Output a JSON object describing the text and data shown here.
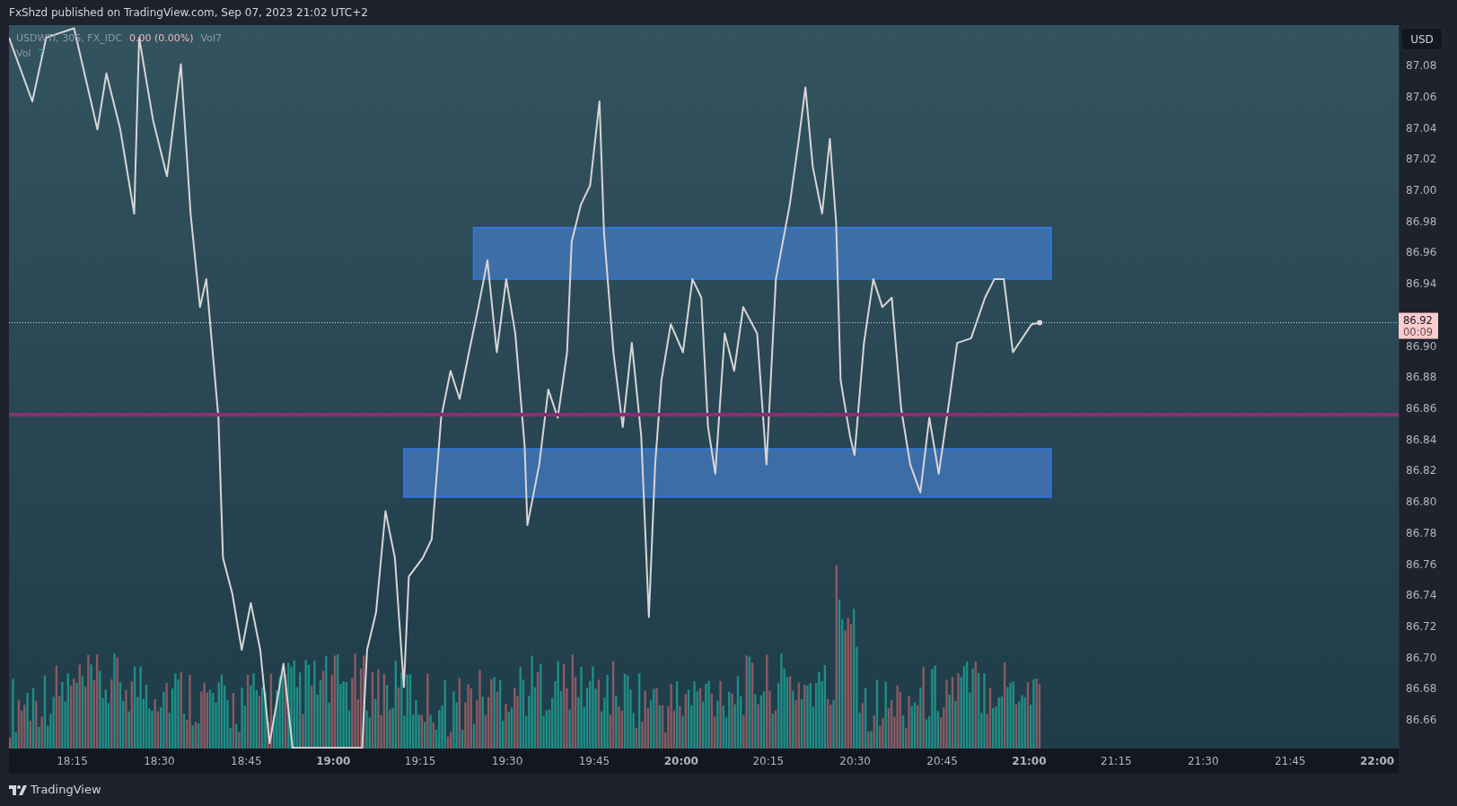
{
  "header": {
    "text": "FxShzd published on TradingView.com, Sep 07, 2023 21:02 UTC+2"
  },
  "legend": {
    "symbol": "USDWTI, 30S, FX_IDC",
    "change": "0.00 (0.00%)",
    "volume_label": "Vol7",
    "volume_name": "Vol",
    "volume_value": "7"
  },
  "price_axis": {
    "currency": "USD",
    "countdown": "00:09"
  },
  "chart": {
    "chart_data": {
      "type": "line",
      "x": [
        18.068,
        18.135,
        18.175,
        18.255,
        18.322,
        18.348,
        18.388,
        18.428,
        18.442,
        18.482,
        18.522,
        18.562,
        18.59,
        18.617,
        18.635,
        18.67,
        18.683,
        18.71,
        18.737,
        18.763,
        18.79,
        18.817,
        18.857,
        18.883,
        19.083,
        19.097,
        19.123,
        19.15,
        19.177,
        19.203,
        19.217,
        19.257,
        19.283,
        19.31,
        19.337,
        19.363,
        19.39,
        19.417,
        19.443,
        19.47,
        19.497,
        19.523,
        19.55,
        19.558,
        19.592,
        19.618,
        19.645,
        19.672,
        19.685,
        19.712,
        19.738,
        19.765,
        19.778,
        19.805,
        19.832,
        19.858,
        19.885,
        19.907,
        19.925,
        19.943,
        19.97,
        20.005,
        20.032,
        20.058,
        20.077,
        20.098,
        20.125,
        20.152,
        20.178,
        20.218,
        20.245,
        20.272,
        20.312,
        20.338,
        20.357,
        20.378,
        20.405,
        20.427,
        20.445,
        20.458,
        20.485,
        20.498,
        20.525,
        20.552,
        20.578,
        20.605,
        20.632,
        20.658,
        20.687,
        20.713,
        20.74,
        20.767,
        20.793,
        20.833,
        20.873,
        20.9,
        20.927,
        20.953,
        20.98,
        21.007,
        21.03
      ],
      "series": [
        {
          "color": "#d9d5d8",
          "values": [
            87.098,
            87.057,
            87.098,
            87.104,
            87.039,
            87.075,
            87.039,
            86.985,
            87.098,
            87.045,
            87.009,
            87.081,
            86.985,
            86.925,
            86.943,
            86.854,
            86.764,
            86.741,
            86.705,
            86.735,
            86.705,
            86.645,
            86.696,
            86.642,
            86.642,
            86.705,
            86.729,
            86.794,
            86.764,
            86.681,
            86.752,
            86.764,
            86.776,
            86.854,
            86.884,
            86.866,
            86.896,
            86.925,
            86.955,
            86.896,
            86.943,
            86.908,
            86.836,
            86.785,
            86.824,
            86.872,
            86.854,
            86.896,
            86.967,
            86.991,
            87.003,
            87.057,
            86.973,
            86.896,
            86.848,
            86.902,
            86.842,
            86.726,
            86.824,
            86.878,
            86.914,
            86.896,
            86.943,
            86.931,
            86.848,
            86.818,
            86.908,
            86.884,
            86.925,
            86.908,
            86.824,
            86.943,
            86.991,
            87.033,
            87.066,
            87.015,
            86.985,
            87.033,
            86.979,
            86.878,
            86.842,
            86.83,
            86.902,
            86.943,
            86.925,
            86.931,
            86.86,
            86.824,
            86.806,
            86.854,
            86.818,
            86.86,
            86.902,
            86.905,
            86.931,
            86.943,
            86.943,
            86.896,
            86.905,
            86.914,
            86.915
          ]
        }
      ],
      "xlim": [
        18.068,
        22.0617
      ],
      "ylim": [
        86.6416,
        87.106
      ],
      "xticks": [
        {
          "value": 18.25,
          "label": "18:15"
        },
        {
          "value": 18.5,
          "label": "18:30"
        },
        {
          "value": 18.75,
          "label": "18:45"
        },
        {
          "value": 19,
          "label": "19:00"
        },
        {
          "value": 19.25,
          "label": "19:15"
        },
        {
          "value": 19.5,
          "label": "19:30"
        },
        {
          "value": 19.75,
          "label": "19:45"
        },
        {
          "value": 20,
          "label": "20:00"
        },
        {
          "value": 20.25,
          "label": "20:15"
        },
        {
          "value": 20.5,
          "label": "20:30"
        },
        {
          "value": 20.75,
          "label": "20:45"
        },
        {
          "value": 21,
          "label": "21:00"
        },
        {
          "value": 21.25,
          "label": "21:15"
        },
        {
          "value": 21.5,
          "label": "21:30"
        },
        {
          "value": 21.75,
          "label": "21:45"
        },
        {
          "value": 22,
          "label": "22:00"
        }
      ],
      "yticks": [
        {
          "value": 87.08,
          "label": "87.08"
        },
        {
          "value": 87.06,
          "label": "87.06"
        },
        {
          "value": 87.04,
          "label": "87.04"
        },
        {
          "value": 87.02,
          "label": "87.02"
        },
        {
          "value": 87.0,
          "label": "87.00"
        },
        {
          "value": 86.98,
          "label": "86.98"
        },
        {
          "value": 86.96,
          "label": "86.96"
        },
        {
          "value": 86.94,
          "label": "86.94"
        },
        {
          "value": 86.9,
          "label": "86.90"
        },
        {
          "value": 86.88,
          "label": "86.88"
        },
        {
          "value": 86.86,
          "label": "86.86"
        },
        {
          "value": 86.84,
          "label": "86.84"
        },
        {
          "value": 86.82,
          "label": "86.82"
        },
        {
          "value": 86.8,
          "label": "86.80"
        },
        {
          "value": 86.78,
          "label": "86.78"
        },
        {
          "value": 86.76,
          "label": "86.76"
        },
        {
          "value": 86.74,
          "label": "86.74"
        },
        {
          "value": 86.72,
          "label": "86.72"
        },
        {
          "value": 86.7,
          "label": "86.70"
        },
        {
          "value": 86.68,
          "label": "86.68"
        },
        {
          "value": 86.66,
          "label": "86.66"
        }
      ],
      "bands": [
        {
          "axis": "y",
          "from": 86.943,
          "to": 86.976
        },
        {
          "axis": "y",
          "from": 86.803,
          "to": 86.834
        }
      ],
      "ref_lines": [
        {
          "axis": "y",
          "value": 86.856
        },
        {
          "axis": "y",
          "value": 86.915,
          "label": "86.92"
        }
      ]
    }
  },
  "footer": {
    "brand": "TradingView"
  }
}
